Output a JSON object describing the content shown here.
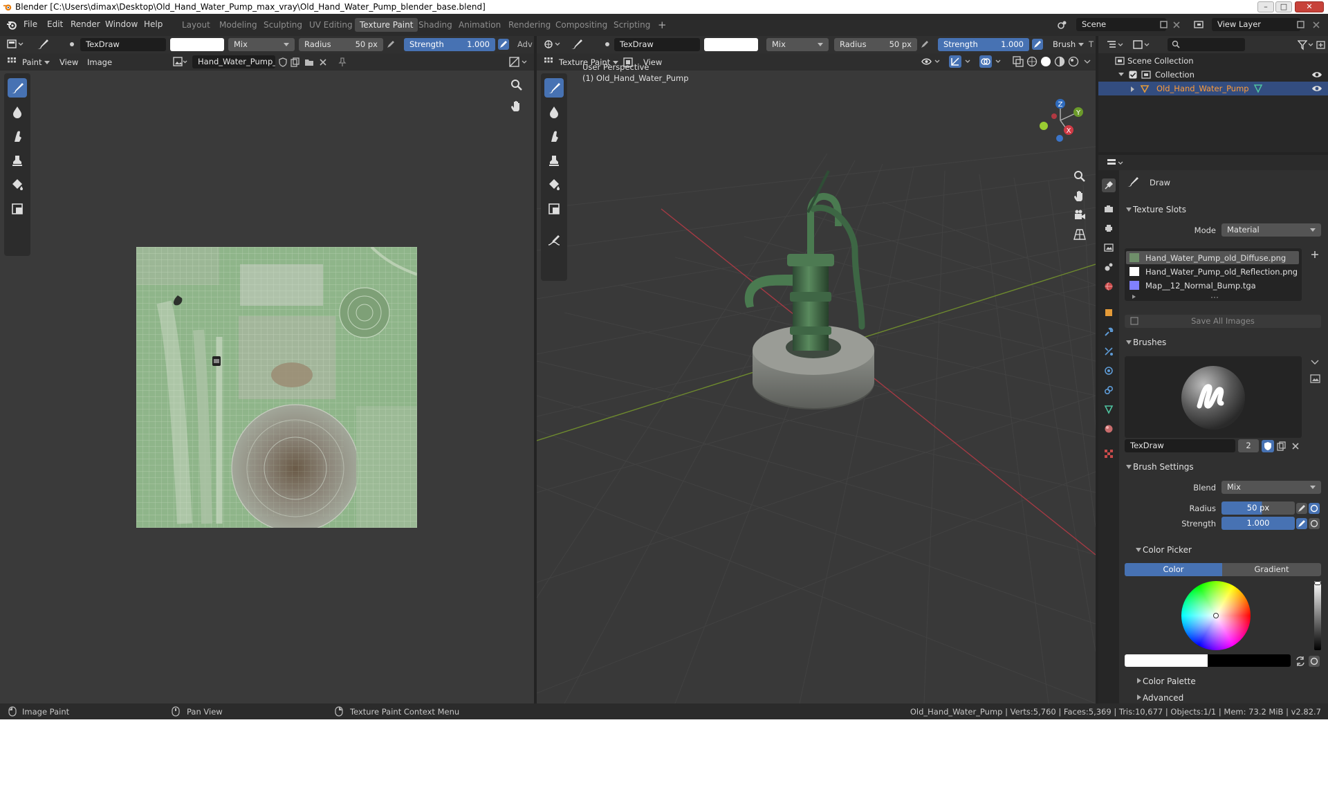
{
  "window": {
    "title": "Blender [C:\\Users\\dimax\\Desktop\\Old_Hand_Water_Pump_max_vray\\Old_Hand_Water_Pump_blender_base.blend]",
    "minimize_glyph": "–",
    "maximize_glyph": "□",
    "close_glyph": "✕"
  },
  "menu": {
    "file": "File",
    "edit": "Edit",
    "render": "Render",
    "window": "Window",
    "help": "Help",
    "workspaces": [
      "Layout",
      "Modeling",
      "Sculpting",
      "UV Editing",
      "Texture Paint",
      "Shading",
      "Animation",
      "Rendering",
      "Compositing",
      "Scripting"
    ],
    "active_workspace": "Texture Paint",
    "add_workspace": "+",
    "scene": "Scene",
    "view_layer": "View Layer"
  },
  "image_editor": {
    "toolbar": {
      "brush_name": "TexDraw",
      "blend": "Mix",
      "radius_label": "Radius",
      "radius_value": "50 px",
      "strength_label": "Strength",
      "strength_value": "1.000",
      "adv_label": "Adv"
    },
    "header": {
      "mode": "Paint",
      "view": "View",
      "image": "Image",
      "image_name": "Hand_Water_Pump_..."
    }
  },
  "viewport": {
    "toolbar": {
      "brush_name": "TexDraw",
      "blend": "Mix",
      "radius_label": "Radius",
      "radius_value": "50 px",
      "strength_label": "Strength",
      "strength_value": "1.000",
      "brush_menu": "Brush",
      "trail": "T"
    },
    "header": {
      "mode": "Texture Paint",
      "view": "View"
    },
    "overlay_line1": "User Perspective",
    "overlay_line2": "(1) Old_Hand_Water_Pump",
    "gizmo": {
      "x": "X",
      "y": "Y",
      "z": "Z"
    }
  },
  "outliner": {
    "scene_collection": "Scene Collection",
    "collection": "Collection",
    "object": "Old_Hand_Water_Pump"
  },
  "properties": {
    "tool_name": "Draw",
    "texture_slots": {
      "title": "Texture Slots",
      "mode_label": "Mode",
      "mode_value": "Material",
      "slots": [
        {
          "name": "Hand_Water_Pump_old_Diffuse.png",
          "color": "#6f8f6a"
        },
        {
          "name": "Hand_Water_Pump_old_Reflection.png",
          "color": "#ffffff"
        },
        {
          "name": "Map__12_Normal_Bump.tga",
          "color": "#8080ff"
        }
      ],
      "save_all": "Save All Images"
    },
    "brushes": {
      "title": "Brushes",
      "brush_name": "TexDraw",
      "users": "2"
    },
    "brush_settings": {
      "title": "Brush Settings",
      "blend_label": "Blend",
      "blend_value": "Mix",
      "radius_label": "Radius",
      "radius_value": "50 px",
      "strength_label": "Strength",
      "strength_value": "1.000"
    },
    "color_picker": {
      "title": "Color Picker",
      "tab_color": "Color",
      "tab_gradient": "Gradient"
    },
    "color_palette": "Color Palette",
    "advanced": "Advanced"
  },
  "status": {
    "left": "Image Paint",
    "middle": "Pan View",
    "right_hint": "Texture Paint Context Menu",
    "stats": "Old_Hand_Water_Pump | Verts:5,760 | Faces:5,369 | Tris:10,677 | Objects:1/1 | Mem: 73.2 MiB | v2.82.7"
  },
  "colors": {
    "accent": "#4772b3",
    "panel": "#303030",
    "region": "#3d3d3d",
    "viewport": "#393939",
    "selected_row": "#334d80",
    "x_axis": "#b7414a",
    "y_axis": "#7c9a28"
  }
}
